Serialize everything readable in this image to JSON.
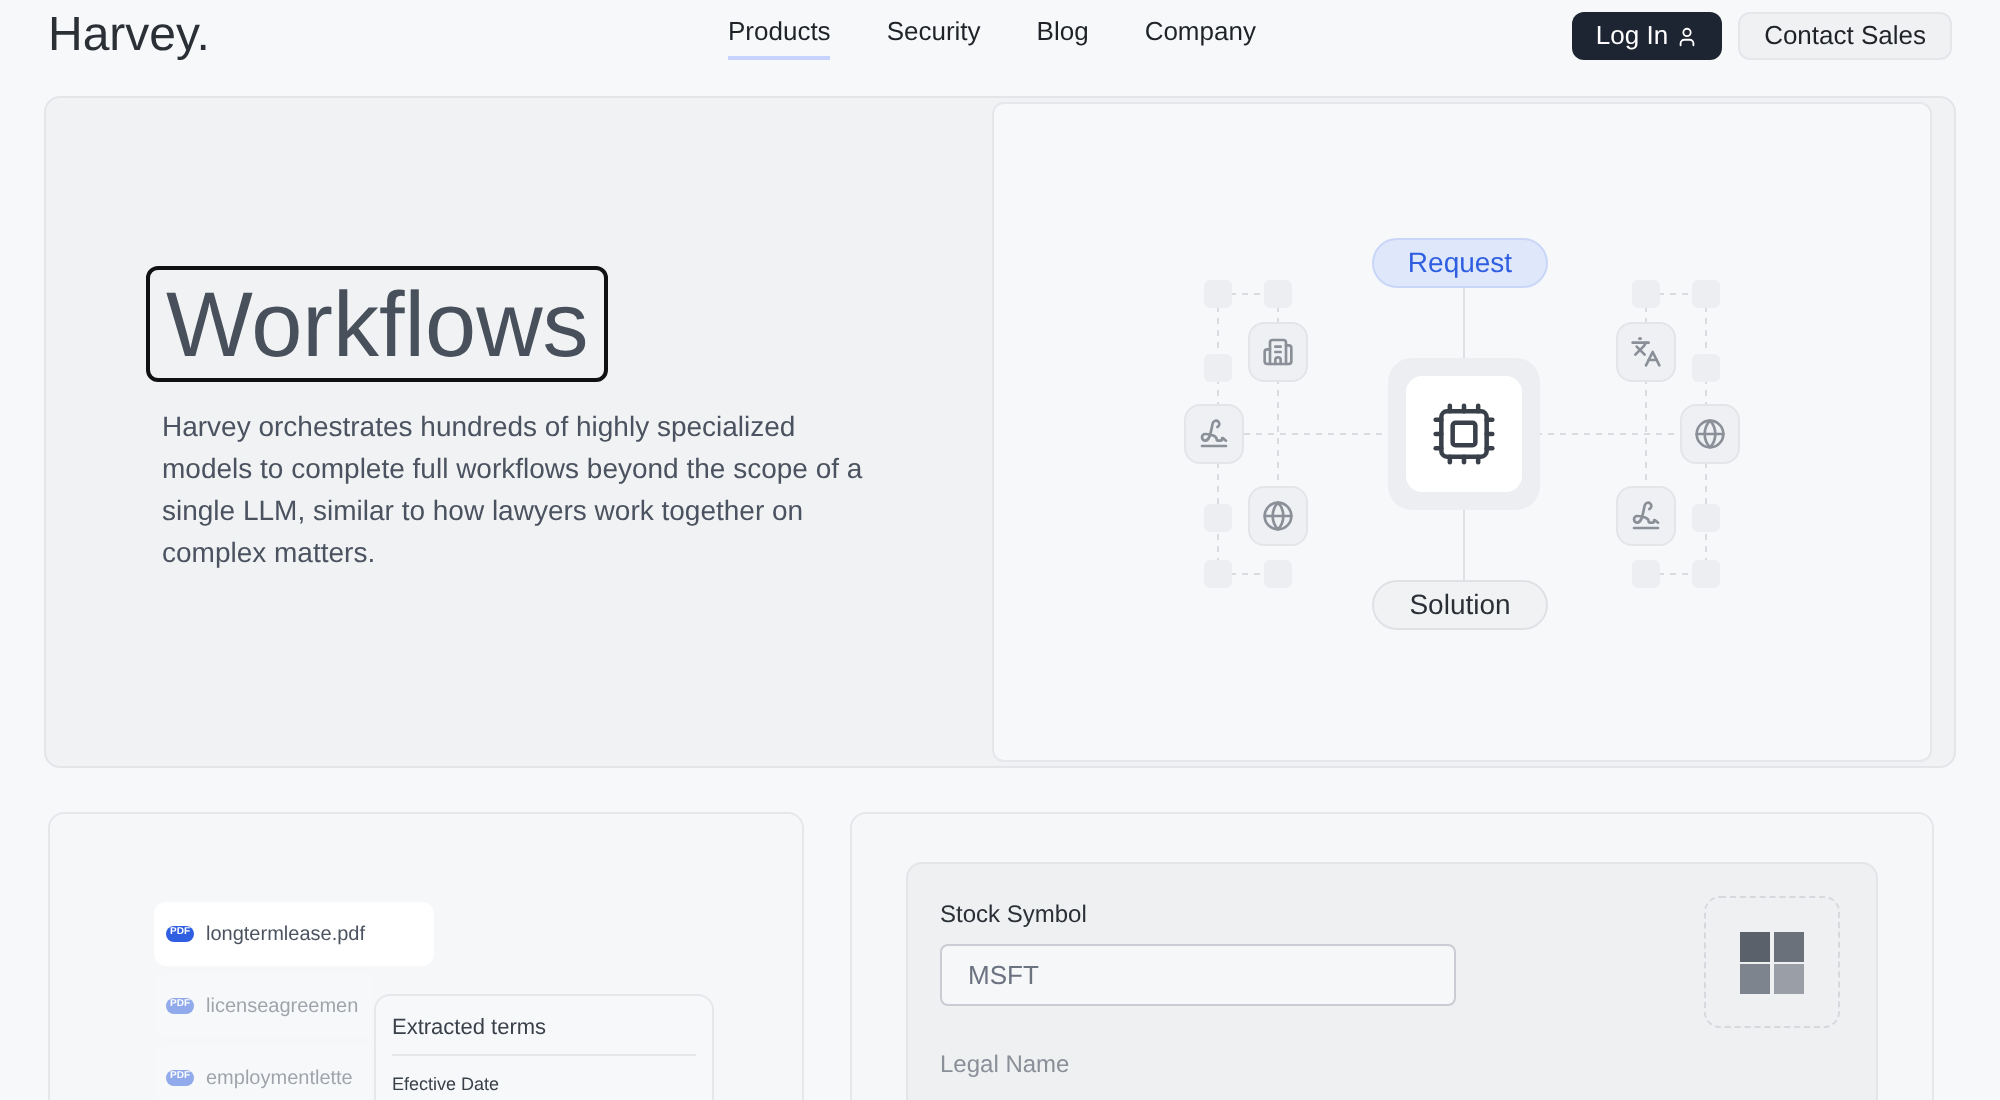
{
  "header": {
    "logo": "Harvey.",
    "nav": [
      {
        "label": "Products",
        "selected": true
      },
      {
        "label": "Security",
        "selected": false
      },
      {
        "label": "Blog",
        "selected": false
      },
      {
        "label": "Company",
        "selected": false
      }
    ],
    "login": "Log In",
    "contact": "Contact Sales"
  },
  "hero": {
    "title": "Workflows",
    "body": "Harvey orchestrates hundreds of highly specialized models to complete full workflows beyond the scope of a single LLM, similar to how lawyers work together on complex matters.",
    "diagram": {
      "request": "Request",
      "solution": "Solution"
    }
  },
  "files": [
    {
      "name": "longtermlease.pdf",
      "badge": "PDF",
      "selected": true
    },
    {
      "name": "licenseagreemen",
      "badge": "PDF",
      "selected": false
    },
    {
      "name": "employmentlette",
      "badge": "PDF",
      "selected": false
    }
  ],
  "extracted": {
    "title": "Extracted terms",
    "first_term": "Efective Date"
  },
  "form": {
    "label": "Stock Symbol",
    "value": "MSFT",
    "next_label": "Legal Name"
  }
}
